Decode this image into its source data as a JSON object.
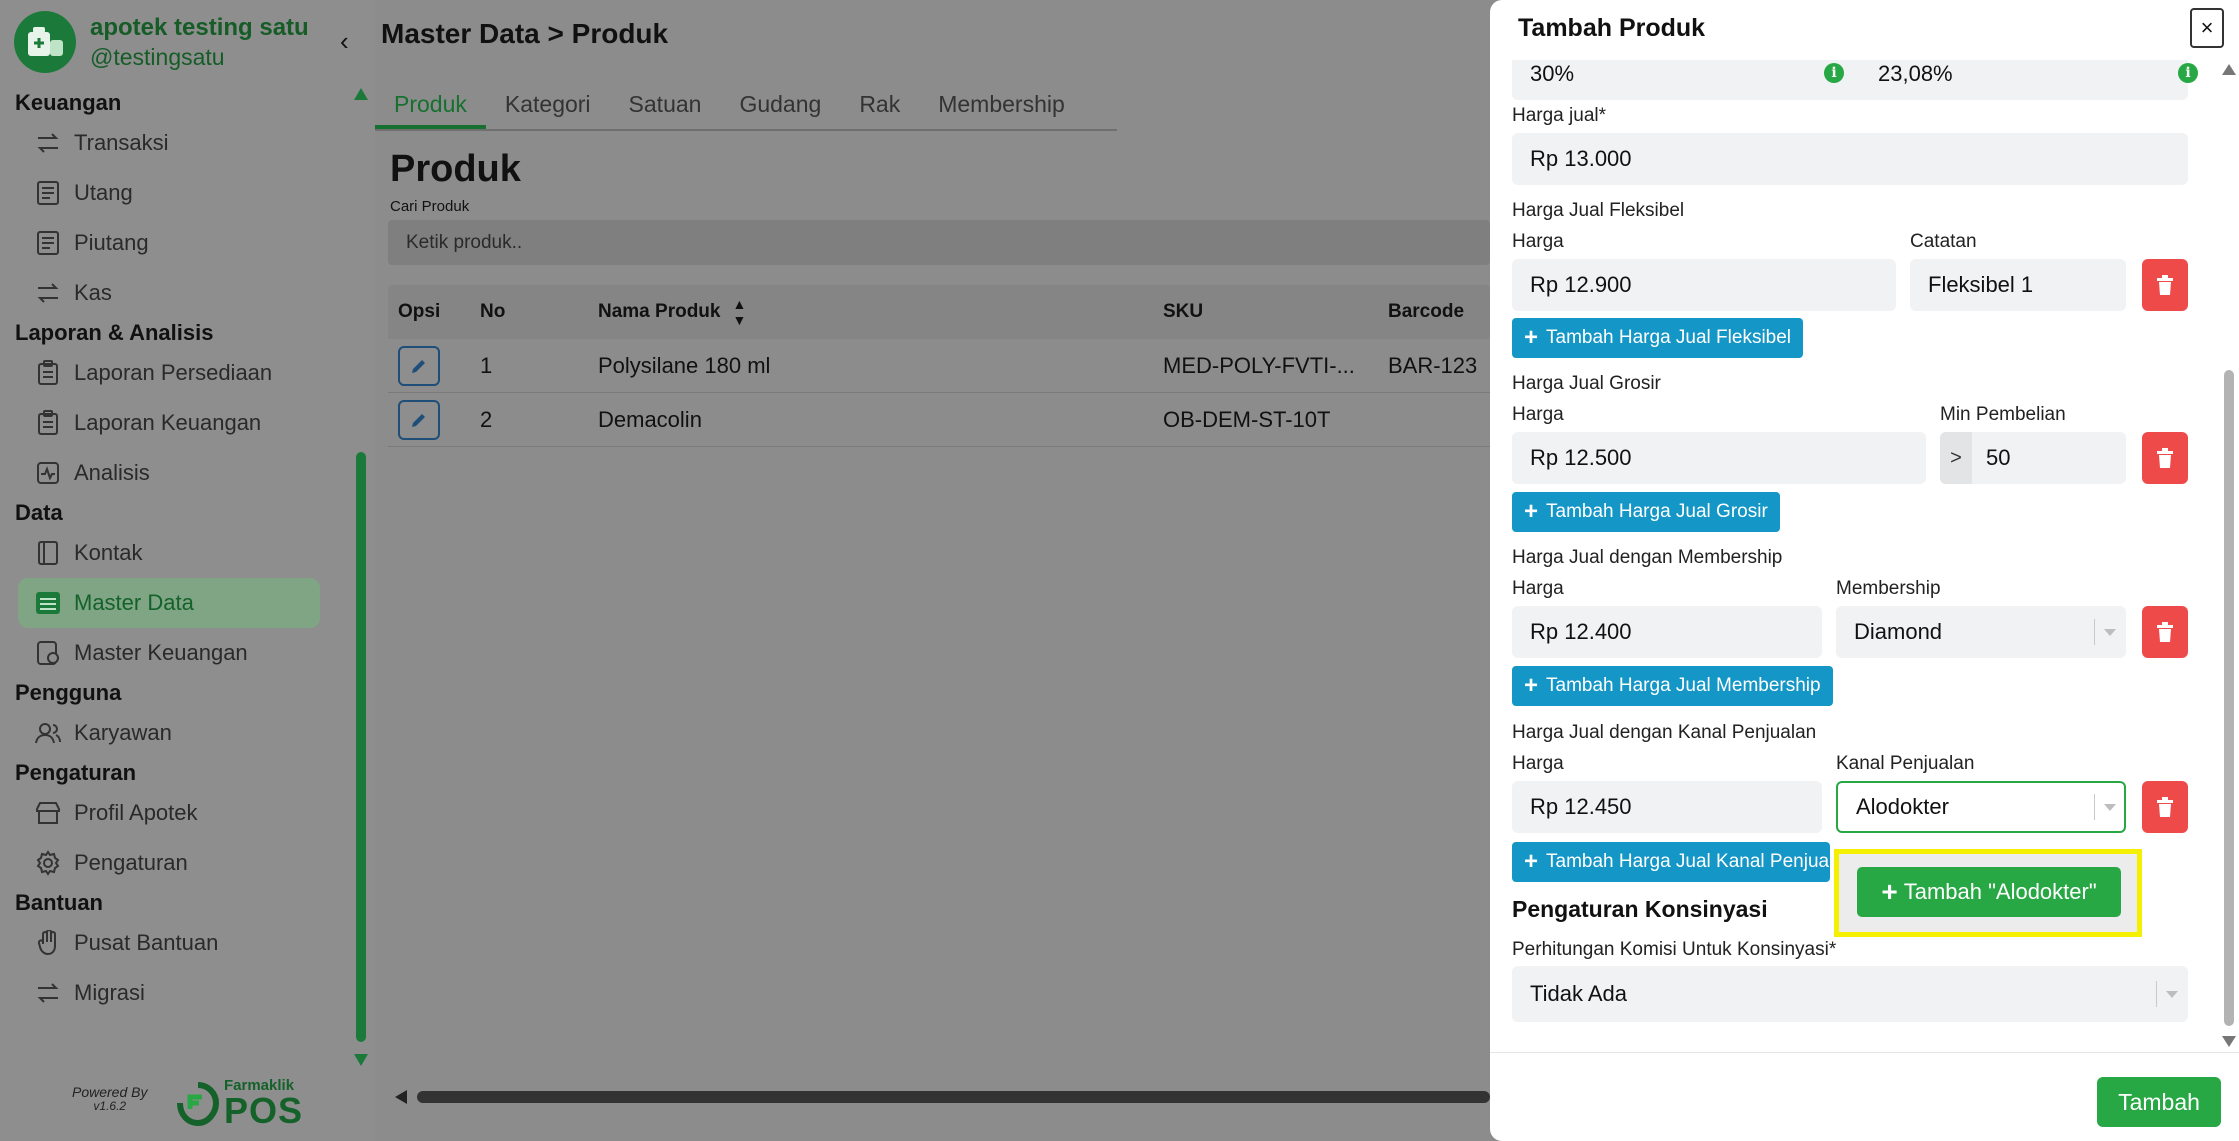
{
  "brand": {
    "name": "apotek testing satu",
    "handle": "@testingsatu"
  },
  "sidebar": {
    "sections": [
      {
        "title": "Keuangan",
        "items": [
          "Transaksi",
          "Utang",
          "Piutang",
          "Kas"
        ]
      },
      {
        "title": "Laporan & Analisis",
        "items": [
          "Laporan Persediaan",
          "Laporan Keuangan",
          "Analisis"
        ]
      },
      {
        "title": "Data",
        "items": [
          "Kontak",
          "Master Data",
          "Master Keuangan"
        ]
      },
      {
        "title": "Pengguna",
        "items": [
          "Karyawan"
        ]
      },
      {
        "title": "Pengaturan",
        "items": [
          "Profil Apotek",
          "Pengaturan"
        ]
      },
      {
        "title": "Bantuan",
        "items": [
          "Pusat Bantuan",
          "Migrasi"
        ]
      }
    ],
    "active_item": "Master Data",
    "powered_by": "Powered By",
    "version": "v1.6.2",
    "footer_logo_small": "Farmaklik",
    "footer_logo_big": "POS"
  },
  "header": {
    "breadcrumb": "Master Data > Produk"
  },
  "tabs": [
    "Produk",
    "Kategori",
    "Satuan",
    "Gudang",
    "Rak",
    "Membership"
  ],
  "active_tab": "Produk",
  "content": {
    "title": "Produk",
    "search_label": "Cari Produk",
    "search_placeholder": "Ketik produk.."
  },
  "table": {
    "columns": {
      "ops": "Opsi",
      "no": "No",
      "name": "Nama Produk",
      "sku": "SKU",
      "barcode": "Barcode"
    },
    "rows": [
      {
        "no": "1",
        "name": "Polysilane 180 ml",
        "sku": "MED-POLY-FVTI-...",
        "barcode": "BAR-123"
      },
      {
        "no": "2",
        "name": "Demacolin",
        "sku": "OB-DEM-ST-10T",
        "barcode": ""
      }
    ]
  },
  "modal": {
    "title": "Tambah Produk",
    "close": "×",
    "margin_value_1": "30%",
    "margin_value_2": "23,08%",
    "harga_jual_label": "Harga jual*",
    "harga_jual_value": "Rp 13.000",
    "fleksibel": {
      "section": "Harga Jual Fleksibel",
      "harga_label": "Harga",
      "catatan_label": "Catatan",
      "harga_value": "Rp 12.900",
      "catatan_value": "Fleksibel 1",
      "add_label": "Tambah Harga Jual Fleksibel"
    },
    "grosir": {
      "section": "Harga Jual Grosir",
      "harga_label": "Harga",
      "min_label": "Min Pembelian",
      "harga_value": "Rp 12.500",
      "min_prefix": ">",
      "min_value": "50",
      "add_label": "Tambah Harga Jual Grosir"
    },
    "membership": {
      "section": "Harga Jual dengan Membership",
      "harga_label": "Harga",
      "membership_label": "Membership",
      "harga_value": "Rp 12.400",
      "membership_value": "Diamond",
      "add_label": "Tambah Harga Jual Membership"
    },
    "kanal": {
      "section": "Harga Jual dengan Kanal Penjualan",
      "harga_label": "Harga",
      "kanal_label": "Kanal Penjualan",
      "harga_value": "Rp 12.450",
      "kanal_value": "Alodokter",
      "add_label": "Tambah Harga Jual Kanal Penjualan"
    },
    "popup_add_label": "Tambah \"Alodokter\"",
    "konsinyasi": {
      "section": "Pengaturan Konsinyasi",
      "komisi_label": "Perhitungan Komisi Untuk Konsinyasi*",
      "komisi_value": "Tidak Ada"
    },
    "submit_label": "Tambah"
  },
  "colors": {
    "brand_green": "#27a844",
    "dark_green": "#16702f",
    "info_blue": "#1496c6",
    "danger_red": "#ef4a4a",
    "highlight_yellow": "#f5f000"
  }
}
